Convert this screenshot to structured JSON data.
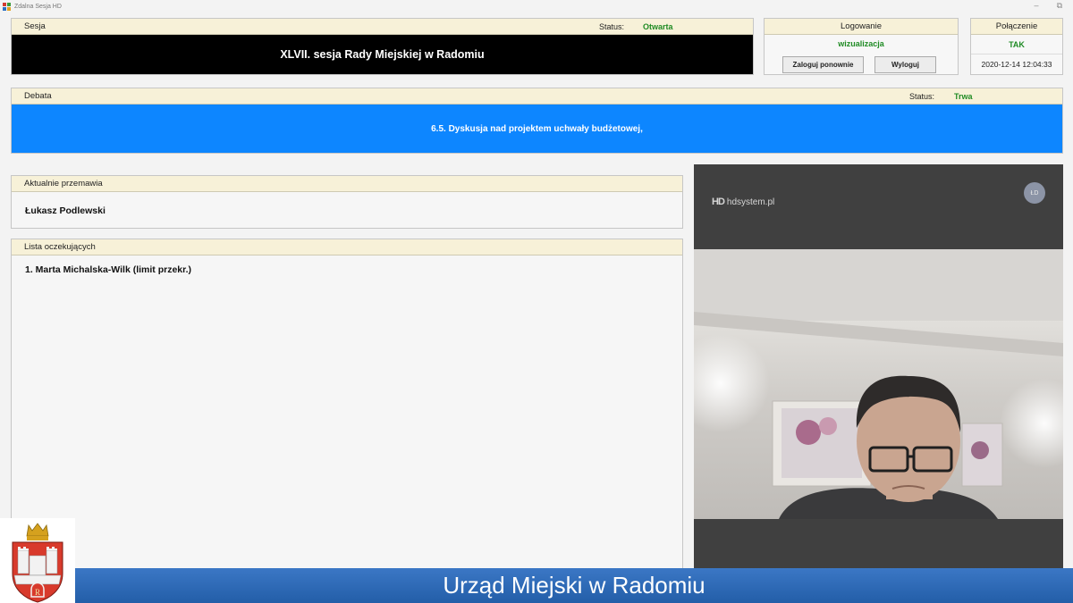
{
  "window": {
    "title": "Zdalna Sesja HD",
    "minimize": "–",
    "restore": "⧉"
  },
  "sesja": {
    "header": "Sesja",
    "status_label": "Status:",
    "status_value": "Otwarta",
    "name": "XLVII. sesja Rady Miejskiej w Radomiu"
  },
  "logowanie": {
    "header": "Logowanie",
    "user": "wizualizacja",
    "relogin_label": "Zaloguj ponownie",
    "logout_label": "Wyloguj"
  },
  "polaczenie": {
    "header": "Połączenie",
    "value": "TAK",
    "timestamp": "2020-12-14 12:04:33"
  },
  "debata": {
    "header": "Debata",
    "status_label": "Status:",
    "status_value": "Trwa",
    "topic": "6.5. Dyskusja nad projektem uchwały budżetowej,"
  },
  "aktualnie": {
    "header": "Aktualnie przemawia",
    "speaker": "Łukasz Podlewski"
  },
  "lista": {
    "header": "Lista oczekujących",
    "items": [
      "1. Marta Michalska-Wilk (limit przekr.)"
    ]
  },
  "video": {
    "brand_mark": "HD",
    "brand": "hdsystem.pl",
    "avatar_initials": "ŁD"
  },
  "footer": {
    "title": "Urząd Miejski w Radomiu"
  },
  "colors": {
    "header_bg": "#f7f1d8",
    "status_green": "#1f8b24",
    "debata_blue": "#0d86ff",
    "footer_blue": "#2a66b3"
  }
}
